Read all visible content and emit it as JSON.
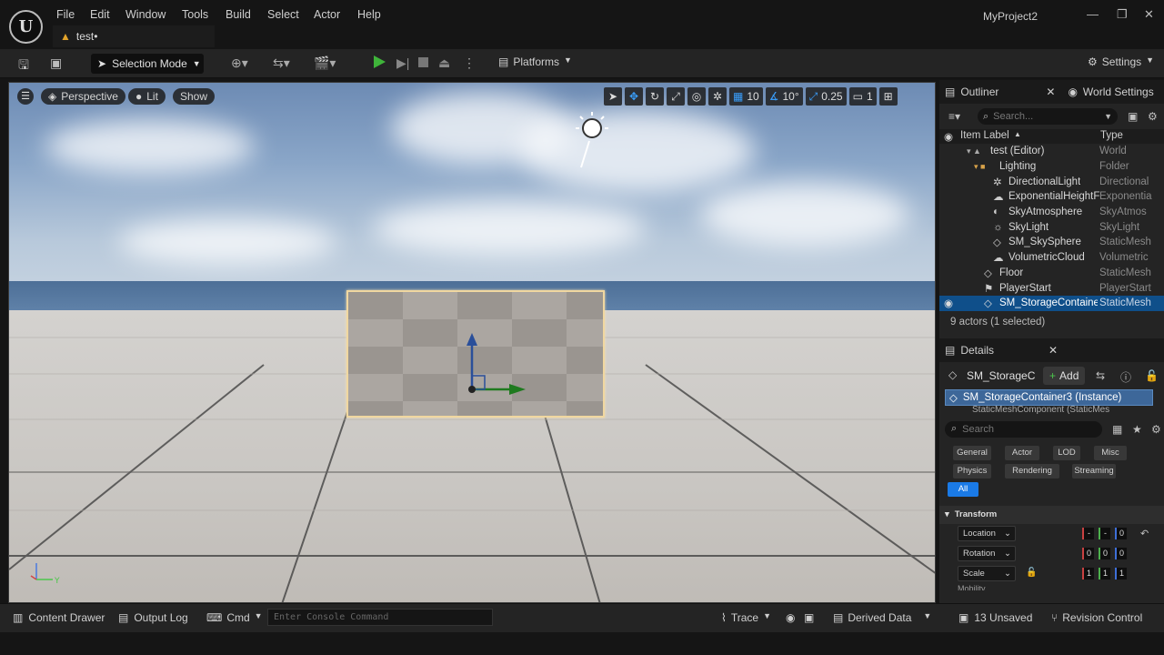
{
  "app": {
    "project_name": "MyProject2",
    "level_tab": "test•",
    "logo": "unreal-engine-logo"
  },
  "menu": [
    "File",
    "Edit",
    "Window",
    "Tools",
    "Build",
    "Select",
    "Actor",
    "Help"
  ],
  "toolbar": {
    "selection_mode": "Selection Mode",
    "platforms": "Platforms",
    "settings": "Settings"
  },
  "viewport": {
    "perspective": "Perspective",
    "lit": "Lit",
    "show": "Show",
    "grid_snap": "10",
    "rotation_snap": "10°",
    "scale_snap": "0.25",
    "camera_speed": "1",
    "axis_y": "Y"
  },
  "outliner": {
    "tab": "Outliner",
    "world_settings_tab": "World Settings",
    "search_placeholder": "Search...",
    "col_label": "Item Label",
    "col_type": "Type",
    "rows": [
      {
        "label": "test (Editor)",
        "type": "World",
        "icon": "world-icon"
      },
      {
        "label": "Lighting",
        "type": "Folder",
        "icon": "folder-icon"
      },
      {
        "label": "DirectionalLight",
        "type": "Directional",
        "icon": "sun-icon"
      },
      {
        "label": "ExponentialHeightF",
        "type": "Exponentia",
        "icon": "fog-icon"
      },
      {
        "label": "SkyAtmosphere",
        "type": "SkyAtmos",
        "icon": "atmosphere-icon"
      },
      {
        "label": "SkyLight",
        "type": "SkyLight",
        "icon": "skylight-icon"
      },
      {
        "label": "SM_SkySphere",
        "type": "StaticMesh",
        "icon": "mesh-icon"
      },
      {
        "label": "VolumetricCloud",
        "type": "Volumetric",
        "icon": "cloud-icon"
      },
      {
        "label": "Floor",
        "type": "StaticMesh",
        "icon": "mesh-icon"
      },
      {
        "label": "PlayerStart",
        "type": "PlayerStart",
        "icon": "player-start-icon"
      },
      {
        "label": "SM_StorageContaine",
        "type": "StaticMesh",
        "icon": "mesh-icon"
      }
    ],
    "status": "9 actors (1 selected)"
  },
  "details": {
    "tab": "Details",
    "actor_name": "SM_StorageC",
    "add": "Add",
    "instance": "SM_StorageContainer3 (Instance)",
    "component": "StaticMeshComponent (StaticMes",
    "search_placeholder": "Search",
    "categories": [
      "General",
      "Actor",
      "LOD",
      "Misc",
      "Physics",
      "Rendering",
      "Streaming",
      "All"
    ],
    "section": "Transform",
    "location": "Location",
    "rotation": "Rotation",
    "scale": "Scale",
    "mobility": "Mobility",
    "loc_vals": [
      "-",
      "-",
      "0"
    ],
    "rot_vals": [
      "0",
      "0",
      "0"
    ],
    "scale_vals": [
      "1",
      "1",
      "1"
    ]
  },
  "bottom": {
    "content_drawer": "Content Drawer",
    "output_log": "Output Log",
    "cmd": "Cmd",
    "console_placeholder": "Enter Console Command",
    "trace": "Trace",
    "derived_data": "Derived Data",
    "unsaved": "13 Unsaved",
    "revision": "Revision Control"
  }
}
